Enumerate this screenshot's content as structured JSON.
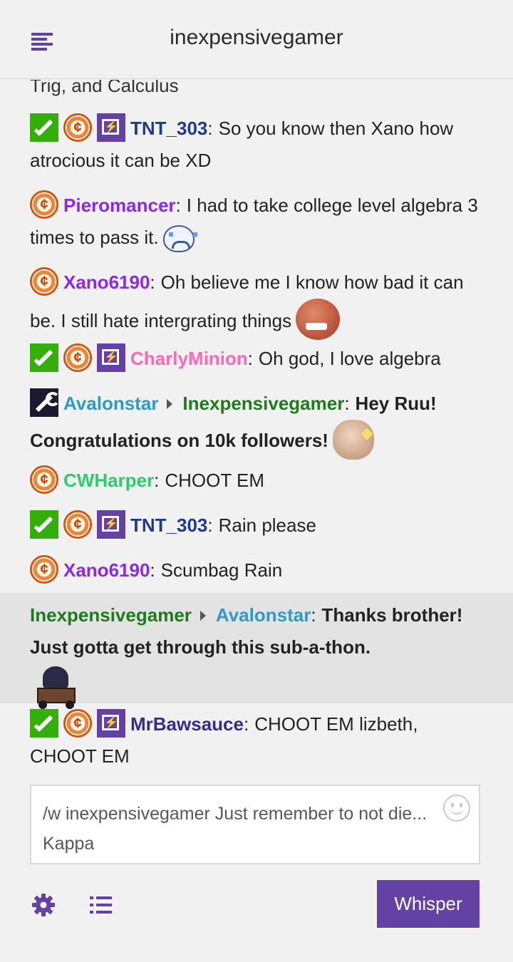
{
  "header": {
    "title": "inexpensivegamer",
    "menu_icon": "menu-icon"
  },
  "colors": {
    "accent": "#6441a5",
    "mod_green": "#34ae0a",
    "highlight": "#e3e3e3"
  },
  "chat": {
    "partial_text": "Trig, and Calculus",
    "messages": [
      {
        "badges": [
          "mod",
          "bits",
          "turbo"
        ],
        "user": "TNT_303",
        "color": "#1e3a8a",
        "text": "So you know then Xano how atrocious it can be XD"
      },
      {
        "badges": [
          "bits"
        ],
        "user": "Pieromancer",
        "color": "#8a2be2",
        "text": "I had to take college level algebra 3 times to pass it.",
        "emote": "cry-emote"
      },
      {
        "badges": [
          "bits"
        ],
        "user": "Xano6190",
        "color": "#8a2be2",
        "text": "Oh believe me I know how bad it can be. I still hate intergrating things",
        "emote": "angry-emote"
      },
      {
        "badges": [
          "mod",
          "bits",
          "turbo"
        ],
        "user": "CharlyMinion",
        "color": "#ff69b4",
        "text": "Oh god, I love algebra"
      },
      {
        "badges": [
          "staff"
        ],
        "user": "Avalonstar",
        "color": "#2e9bc4",
        "to": "Inexpensivegamer",
        "to_color": "#1e7b1e",
        "text": "Hey Ruu! Congratulations on 10k followers!",
        "emote": "kappa-emote",
        "whisper": true
      },
      {
        "badges": [
          "bits"
        ],
        "user": "CWHarper",
        "color": "#2ecc71",
        "text": "CHOOT EM"
      },
      {
        "badges": [
          "mod",
          "bits",
          "turbo"
        ],
        "user": "TNT_303",
        "color": "#1e3a8a",
        "text": "Rain please"
      },
      {
        "badges": [
          "bits"
        ],
        "user": "Xano6190",
        "color": "#8a2be2",
        "text": "Scumbag Rain"
      },
      {
        "badges": [],
        "user": "Inexpensivegamer",
        "color": "#1e7b1e",
        "to": "Avalonstar",
        "to_color": "#2e9bc4",
        "text": "Thanks brother! Just gotta get through this sub-a-thon.",
        "emote": "hat-cart-emote",
        "whisper": true,
        "highlighted": true
      },
      {
        "badges": [
          "mod",
          "bits",
          "turbo"
        ],
        "user": "MrBawsauce",
        "color": "#3a2a8a",
        "text": "CHOOT EM lizbeth, CHOOT EM"
      }
    ]
  },
  "input": {
    "value": "/w inexpensivegamer Just remember to not die... Kappa",
    "emoji_icon": "smiley-icon"
  },
  "footer": {
    "settings_icon": "gear-icon",
    "list_icon": "list-icon",
    "whisper_label": "Whisper"
  }
}
